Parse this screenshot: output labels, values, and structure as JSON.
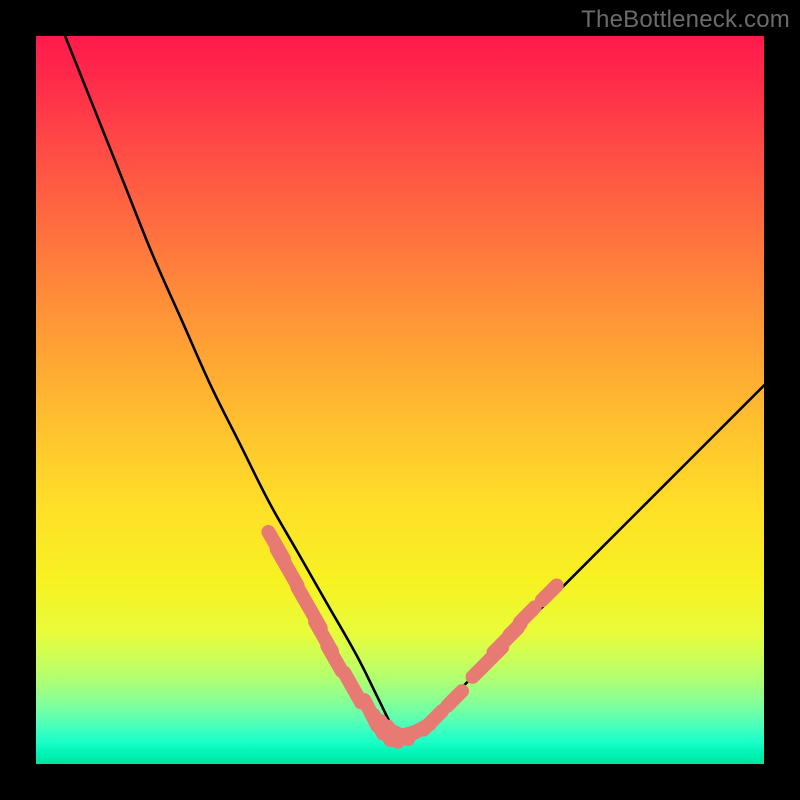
{
  "watermark": "TheBottleneck.com",
  "colors": {
    "curve": "#000000",
    "marker_fill": "#e87a74",
    "marker_stroke": "#e87a74",
    "background_top": "#ff1a4d",
    "background_bottom": "#00e49c"
  },
  "chart_data": {
    "type": "line",
    "title": "",
    "xlabel": "",
    "ylabel": "",
    "xlim": [
      0,
      100
    ],
    "ylim": [
      0,
      100
    ],
    "grid": false,
    "note": "Black V-curve on a vertical heat-map gradient (red→orange→yellow→green). Y represents bottleneck % (high=bad), minimum near x≈50. Pink pill markers cluster along the low part of the curve.",
    "series": [
      {
        "name": "bottleneck-curve",
        "x": [
          0,
          4,
          8,
          12,
          16,
          20,
          24,
          28,
          32,
          36,
          40,
          44,
          47,
          49,
          50,
          51,
          53,
          56,
          60,
          66,
          72,
          78,
          84,
          90,
          96,
          100
        ],
        "y": [
          110,
          100,
          90,
          80,
          70,
          61,
          52,
          44,
          36,
          29,
          22,
          15,
          9,
          5,
          4,
          4,
          5,
          8,
          12,
          18,
          24,
          30,
          36,
          42,
          48,
          52
        ]
      }
    ],
    "markers": [
      {
        "x": 33.0,
        "y": 30.0,
        "len": 2.4
      },
      {
        "x": 34.5,
        "y": 27.0,
        "len": 3.2
      },
      {
        "x": 37.5,
        "y": 21.5,
        "len": 3.6
      },
      {
        "x": 39.5,
        "y": 17.5,
        "len": 2.6
      },
      {
        "x": 41.0,
        "y": 14.5,
        "len": 2.2
      },
      {
        "x": 43.5,
        "y": 10.5,
        "len": 2.6
      },
      {
        "x": 46.0,
        "y": 7.0,
        "len": 2.2
      },
      {
        "x": 47.0,
        "y": 5.5,
        "len": 1.6
      },
      {
        "x": 48.0,
        "y": 4.6,
        "len": 1.6
      },
      {
        "x": 49.0,
        "y": 4.1,
        "len": 1.4
      },
      {
        "x": 50.0,
        "y": 4.0,
        "len": 1.4
      },
      {
        "x": 51.0,
        "y": 4.1,
        "len": 1.4
      },
      {
        "x": 52.5,
        "y": 4.6,
        "len": 2.0
      },
      {
        "x": 54.5,
        "y": 6.0,
        "len": 2.0
      },
      {
        "x": 57.5,
        "y": 9.0,
        "len": 1.6
      },
      {
        "x": 62.0,
        "y": 14.0,
        "len": 3.2
      },
      {
        "x": 64.5,
        "y": 17.0,
        "len": 2.6
      },
      {
        "x": 65.8,
        "y": 18.5,
        "len": 1.2
      },
      {
        "x": 67.5,
        "y": 20.5,
        "len": 1.6
      },
      {
        "x": 70.5,
        "y": 23.5,
        "len": 1.6
      }
    ]
  }
}
